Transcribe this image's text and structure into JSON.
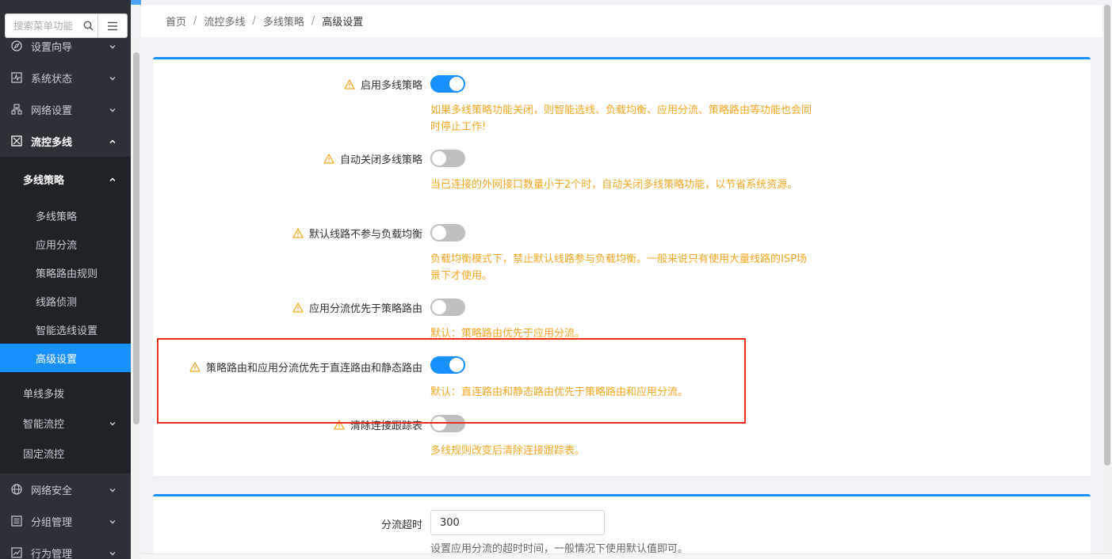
{
  "sidebar": {
    "search_placeholder": "搜索菜单功能",
    "items": [
      {
        "label": "设置向导"
      },
      {
        "label": "系统状态"
      },
      {
        "label": "网络设置"
      },
      {
        "label": "流控多线"
      },
      {
        "label": "网络安全"
      },
      {
        "label": "分组管理"
      },
      {
        "label": "行为管理"
      }
    ],
    "group": {
      "label": "多线策略"
    },
    "sub_items": [
      {
        "label": "多线策略"
      },
      {
        "label": "应用分流"
      },
      {
        "label": "策略路由规则"
      },
      {
        "label": "线路侦测"
      },
      {
        "label": "智能选线设置"
      },
      {
        "label": "高级设置"
      }
    ],
    "other_groups": [
      {
        "label": "单线多拨"
      },
      {
        "label": "智能流控"
      },
      {
        "label": "固定流控"
      }
    ]
  },
  "breadcrumb": [
    "首页",
    "流控多线",
    "多线策略",
    "高级设置"
  ],
  "settings": [
    {
      "label": "启用多线策略",
      "enabled": true,
      "hint": "如果多线策略功能关闭，则智能选线、负载均衡、应用分流、策略路由等功能也会同时停止工作!"
    },
    {
      "label": "自动关闭多线策略",
      "enabled": false,
      "hint": "当已连接的外网接口数量小于2个时，自动关闭多线策略功能，以节省系统资源。"
    },
    {
      "label": "默认线路不参与负载均衡",
      "enabled": false,
      "hint": "负载均衡模式下，禁止默认线路参与负载均衡。一般来说只有使用大量线路的ISP场景下才使用。"
    },
    {
      "label": "应用分流优先于策略路由",
      "enabled": false,
      "hint": "默认：策略路由优先于应用分流。"
    },
    {
      "label": "策略路由和应用分流优先于直连路由和静态路由",
      "enabled": true,
      "hint": "默认：直连路由和静态路由优先于策略路由和应用分流。"
    },
    {
      "label": "清除连接跟踪表",
      "enabled": false,
      "hint": "多线规则改变后清除连接跟踪表。"
    }
  ],
  "timeout": {
    "label": "分流超时",
    "value": "300",
    "hint": "设置应用分流的超时时间，一般情况下使用默认值即可。"
  },
  "colors": {
    "accent": "#1890ff",
    "warning": "#f5a623",
    "highlight": "#e8301c",
    "sidebar": "#2d3036"
  }
}
